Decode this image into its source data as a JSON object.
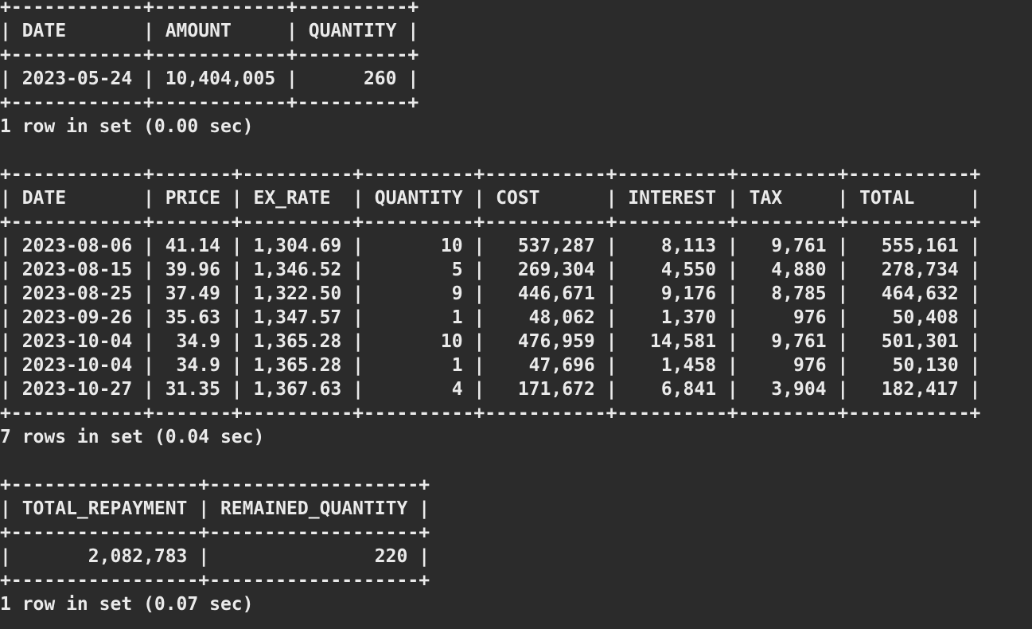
{
  "terminal": {
    "lines": [
      "+------------+------------+----------+",
      "| DATE       | AMOUNT     | QUANTITY |",
      "+------------+------------+----------+",
      "| 2023-05-24 | 10,404,005 |      260 |",
      "+------------+------------+----------+",
      "1 row in set (0.00 sec)",
      "",
      "+------------+-------+----------+----------+-----------+----------+---------+-----------+",
      "| DATE       | PRICE | EX_RATE  | QUANTITY | COST      | INTEREST | TAX     | TOTAL     |",
      "+------------+-------+----------+----------+-----------+----------+---------+-----------+",
      "| 2023-08-06 | 41.14 | 1,304.69 |       10 |   537,287 |    8,113 |   9,761 |   555,161 |",
      "| 2023-08-15 | 39.96 | 1,346.52 |        5 |   269,304 |    4,550 |   4,880 |   278,734 |",
      "| 2023-08-25 | 37.49 | 1,322.50 |        9 |   446,671 |    9,176 |   8,785 |   464,632 |",
      "| 2023-09-26 | 35.63 | 1,347.57 |        1 |    48,062 |    1,370 |     976 |    50,408 |",
      "| 2023-10-04 |  34.9 | 1,365.28 |       10 |   476,959 |   14,581 |   9,761 |   501,301 |",
      "| 2023-10-04 |  34.9 | 1,365.28 |        1 |    47,696 |    1,458 |     976 |    50,130 |",
      "| 2023-10-27 | 31.35 | 1,367.63 |        4 |   171,672 |    6,841 |   3,904 |   182,417 |",
      "+------------+-------+----------+----------+-----------+----------+---------+-----------+",
      "7 rows in set (0.04 sec)",
      "",
      "+-----------------+-------------------+",
      "| TOTAL_REPAYMENT | REMAINED_QUANTITY |",
      "+-----------------+-------------------+",
      "|       2,082,783 |               220 |",
      "+-----------------+-------------------+",
      "1 row in set (0.07 sec)"
    ]
  }
}
